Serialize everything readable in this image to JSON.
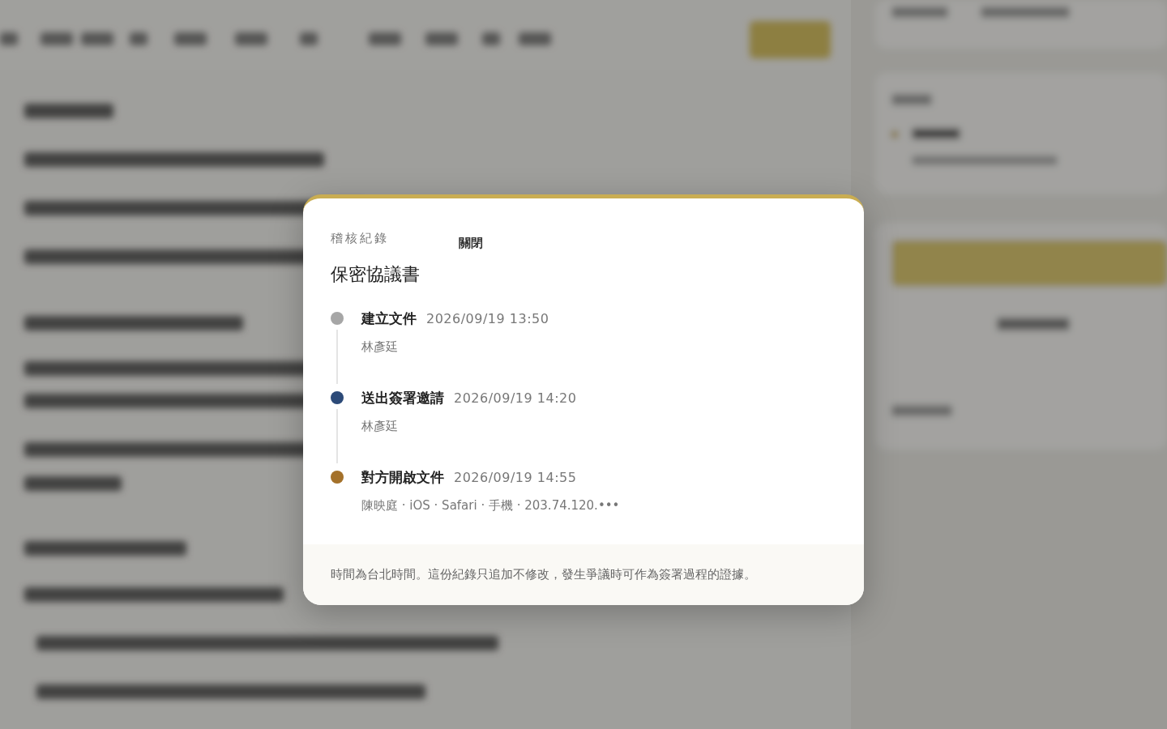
{
  "dialog": {
    "eyebrow": "稽核紀錄",
    "close_label": "關閉",
    "title": "保密協議書",
    "events": [
      {
        "action": "建立文件",
        "time": "2026/09/19 13:50",
        "detail": "林彥廷",
        "color": "#a6a6a6"
      },
      {
        "action": "送出簽署邀請",
        "time": "2026/09/19 14:20",
        "detail": "林彥廷",
        "color": "#2c4a78"
      },
      {
        "action": "對方開啟文件",
        "time": "2026/09/19 14:55",
        "detail": "陳映庭 · iOS · Safari · 手機 · 203.74.120.•••",
        "color": "#a4712a"
      }
    ],
    "footer_note": "時間為台北時間。這份紀錄只追加不修改，發生爭議時可作為簽署過程的證據。"
  }
}
